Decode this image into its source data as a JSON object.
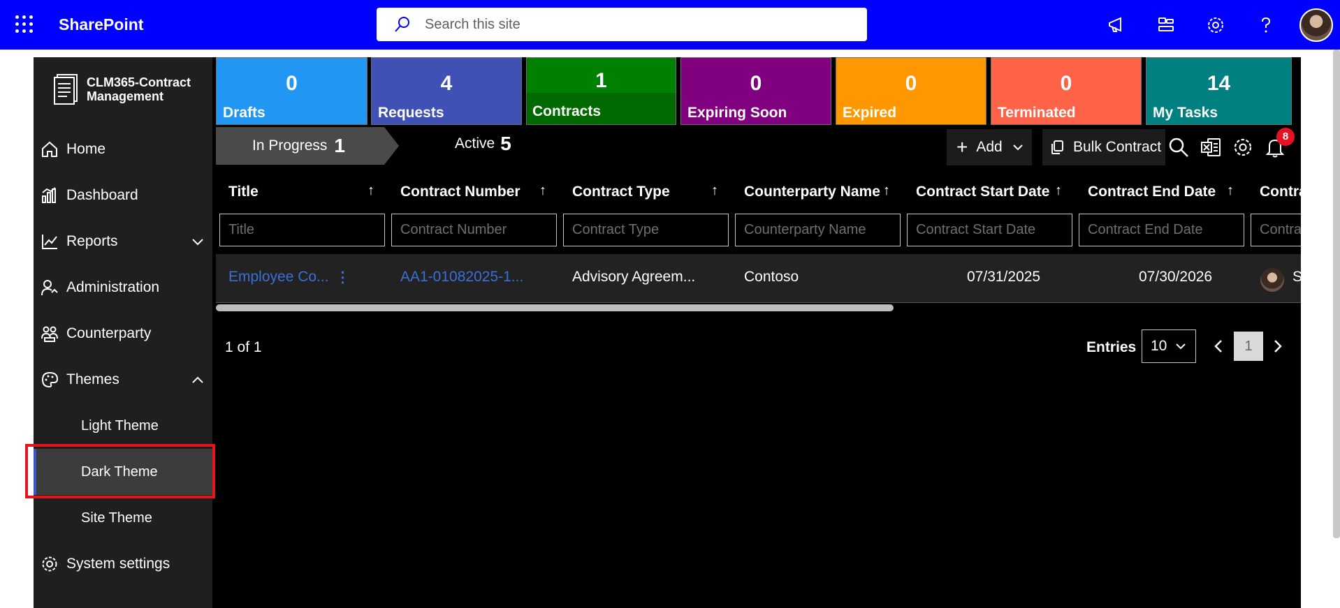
{
  "suitebar": {
    "brand": "SharePoint",
    "search_placeholder": "Search this site"
  },
  "sidebar": {
    "logo_text": "CLM365-Contract Management",
    "items": [
      {
        "label": "Home",
        "icon": "home-icon"
      },
      {
        "label": "Dashboard",
        "icon": "dashboard-icon"
      },
      {
        "label": "Reports",
        "icon": "reports-icon",
        "expanded": false
      },
      {
        "label": "Administration",
        "icon": "administration-icon"
      },
      {
        "label": "Counterparty",
        "icon": "counterparty-icon"
      },
      {
        "label": "Themes",
        "icon": "palette-icon",
        "expanded": true
      },
      {
        "label": "System settings",
        "icon": "gear-icon"
      }
    ],
    "theme_subitems": [
      {
        "label": "Light Theme",
        "selected": false
      },
      {
        "label": "Dark Theme",
        "selected": true
      },
      {
        "label": "Site Theme",
        "selected": false
      }
    ]
  },
  "tiles": [
    {
      "count": "0",
      "label": "Drafts",
      "color": "#2196f3"
    },
    {
      "count": "4",
      "label": "Requests",
      "color": "#3f51b5"
    },
    {
      "count": "1",
      "label": "Contracts",
      "color": "#008000"
    },
    {
      "count": "0",
      "label": "Expiring Soon",
      "color": "#800080"
    },
    {
      "count": "0",
      "label": "Expired",
      "color": "#ff9800"
    },
    {
      "count": "0",
      "label": "Terminated",
      "color": "#ff6347"
    },
    {
      "count": "14",
      "label": "My Tasks",
      "color": "#008080"
    }
  ],
  "tabs": {
    "in_progress": {
      "label": "In Progress",
      "count": "1"
    },
    "active": {
      "label": "Active",
      "count": "5"
    }
  },
  "toolbar": {
    "add_label": "Add",
    "bulk_label": "Bulk Contract",
    "notification_count": "8"
  },
  "table": {
    "columns": [
      {
        "header": "Title",
        "placeholder": "Title"
      },
      {
        "header": "Contract Number",
        "placeholder": "Contract Number"
      },
      {
        "header": "Contract Type",
        "placeholder": "Contract Type"
      },
      {
        "header": "Counterparty Name",
        "placeholder": "Counterparty Name"
      },
      {
        "header": "Contract Start Date",
        "placeholder": "Contract Start Date"
      },
      {
        "header": "Contract End Date",
        "placeholder": "Contract End Date"
      },
      {
        "header": "Contra",
        "placeholder": "Contra"
      }
    ],
    "rows": [
      {
        "title": "Employee Co...",
        "contract_number": "AA1-01082025-1...",
        "contract_type": "Advisory Agreem...",
        "counterparty": "Contoso",
        "start_date": "07/31/2025",
        "end_date": "07/30/2026",
        "owner_initial": "S"
      }
    ]
  },
  "pagination": {
    "info": "1 of 1",
    "entries_label": "Entries",
    "entries_value": "10",
    "current_page": "1"
  }
}
